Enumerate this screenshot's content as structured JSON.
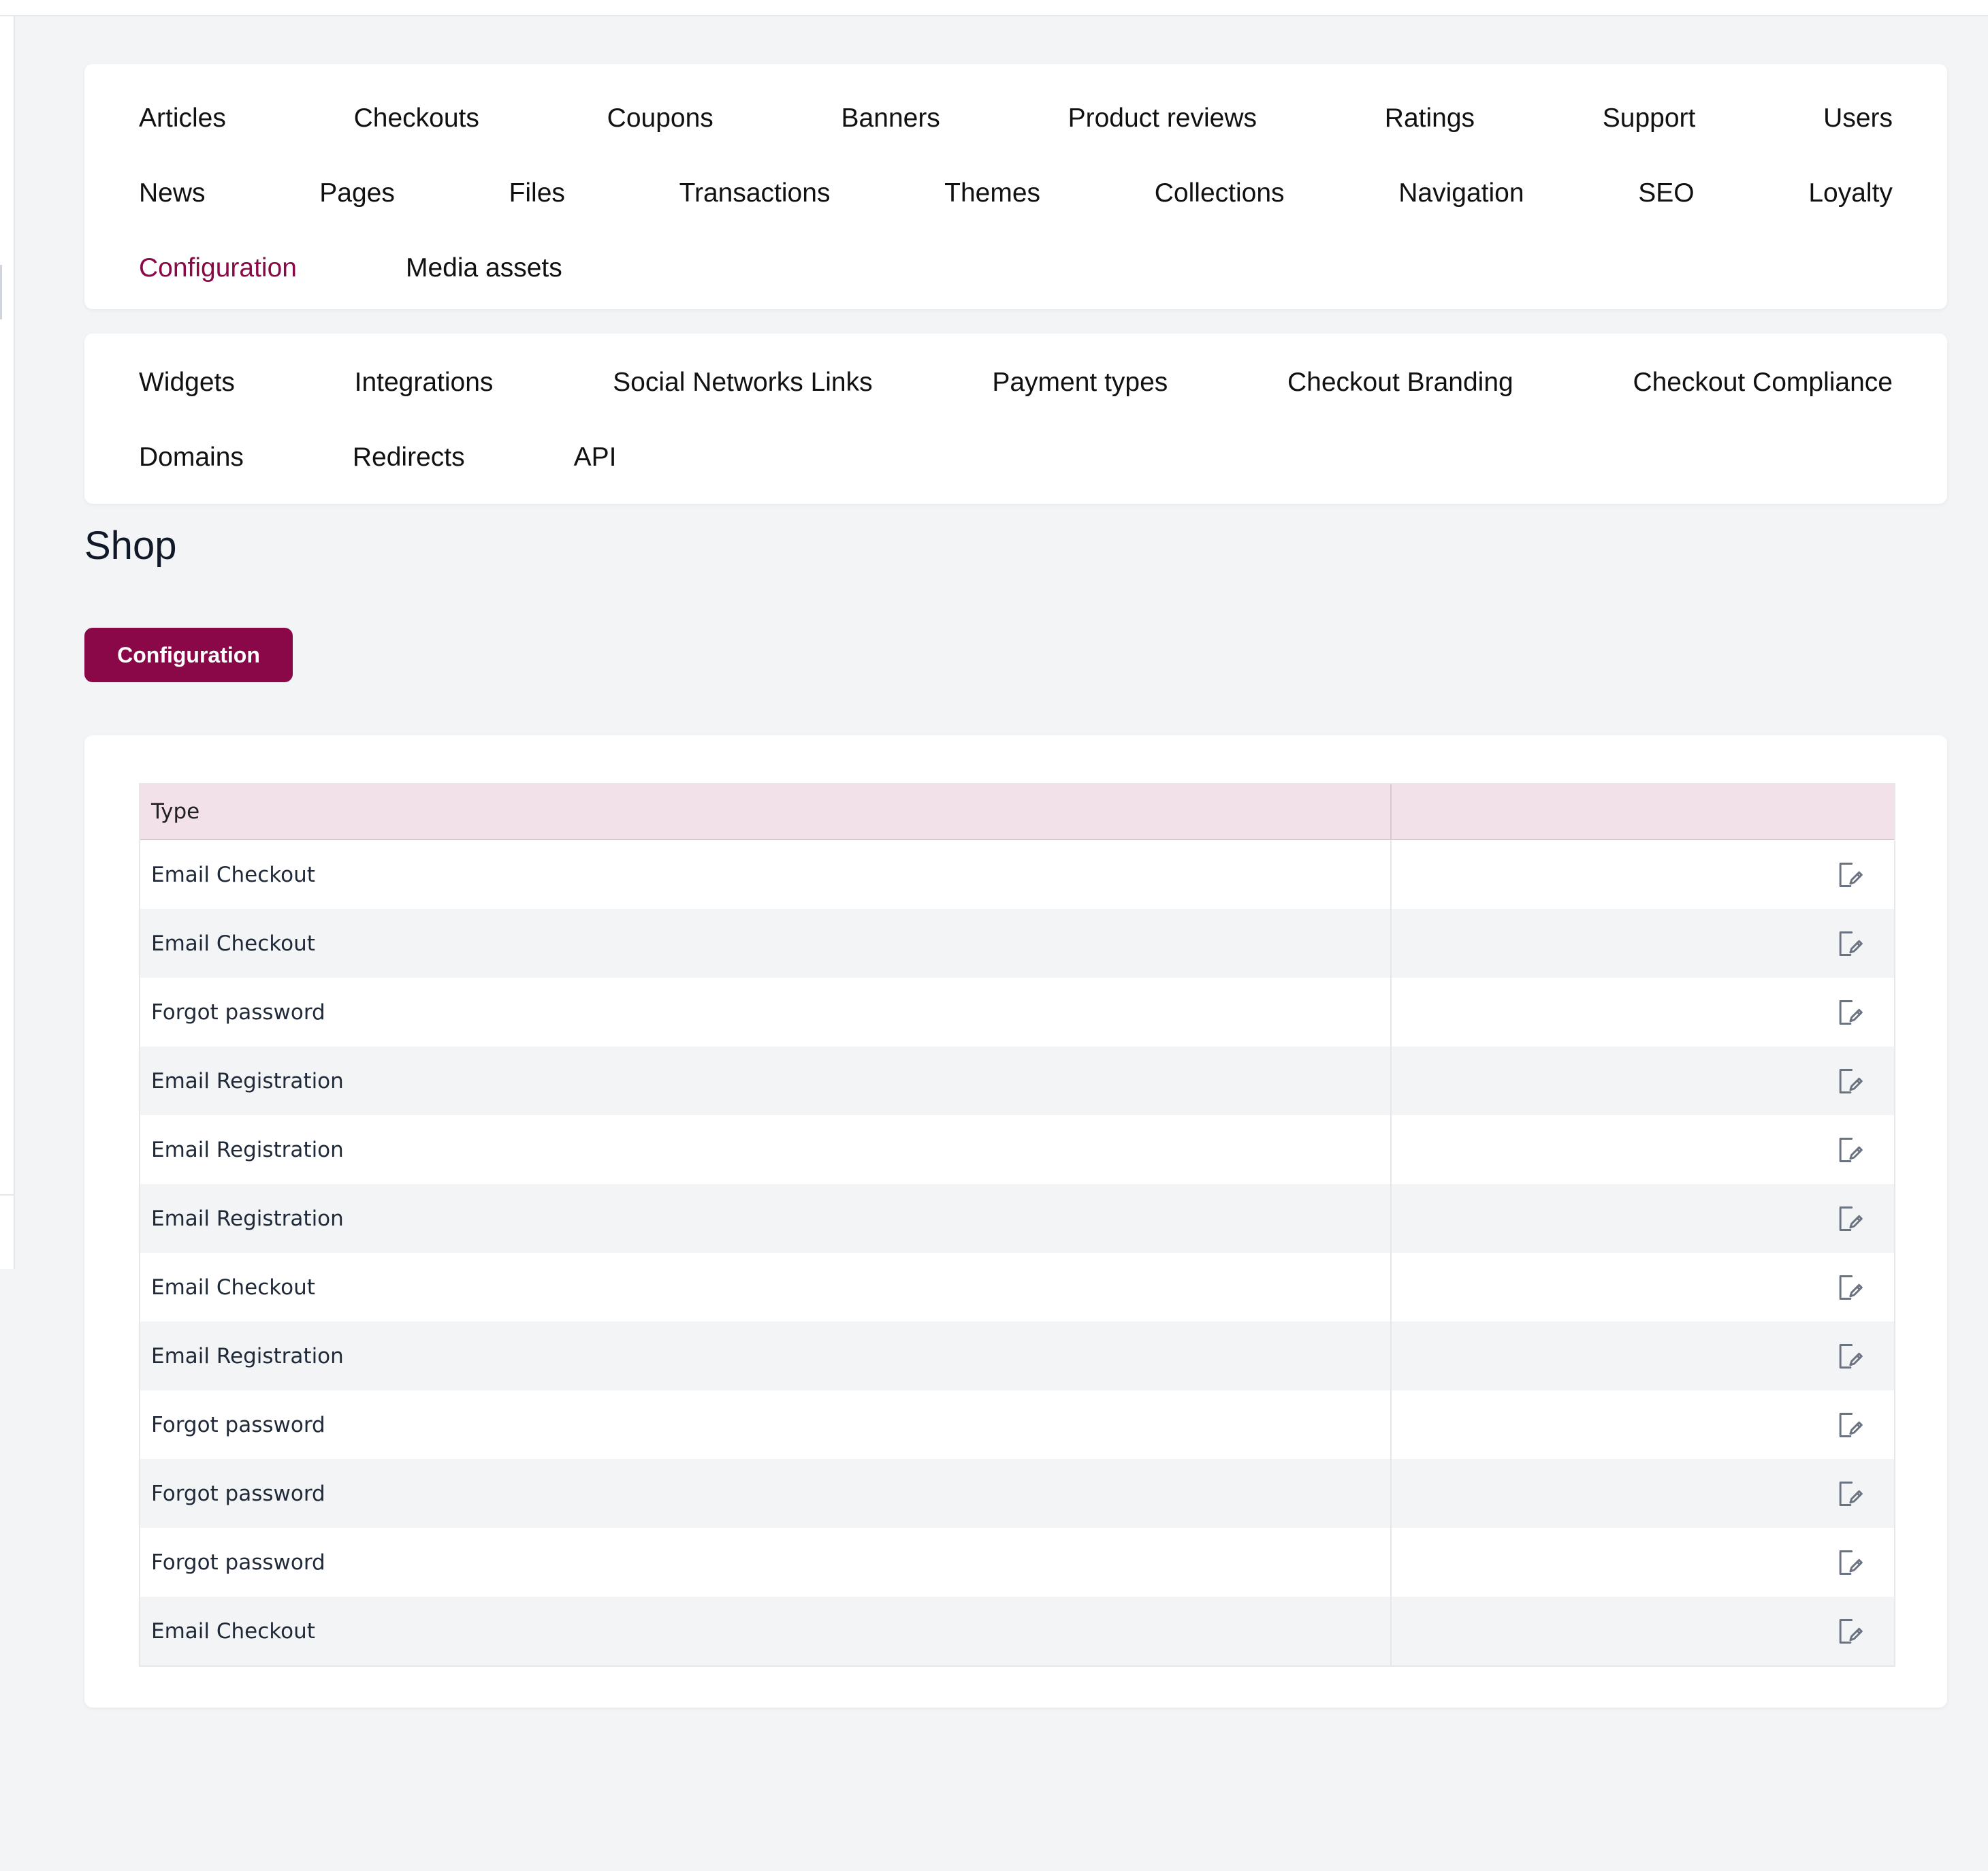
{
  "main_nav": {
    "rows": [
      [
        "Articles",
        "Checkouts",
        "Coupons",
        "Banners",
        "Product reviews",
        "Ratings",
        "Support",
        "Users"
      ],
      [
        "News",
        "Pages",
        "Files",
        "Transactions",
        "Themes",
        "Collections",
        "Navigation",
        "SEO",
        "Loyalty"
      ],
      [
        "Configuration",
        "Media assets"
      ]
    ],
    "active": "Configuration"
  },
  "sub_nav": {
    "rows": [
      [
        "Widgets",
        "Integrations",
        "Social Networks Links",
        "Payment types",
        "Checkout Branding",
        "Checkout Compliance"
      ],
      [
        "Domains",
        "Redirects",
        "API"
      ]
    ]
  },
  "page": {
    "title": "Shop",
    "config_button": "Configuration"
  },
  "table": {
    "columns": [
      "Type",
      ""
    ],
    "rows": [
      "Email Checkout",
      "Email Checkout",
      "Forgot password",
      "Email Registration",
      "Email Registration",
      "Email Registration",
      "Email Checkout",
      "Email Registration",
      "Forgot password",
      "Forgot password",
      "Forgot password",
      "Email Checkout"
    ],
    "row_action_icon": "edit-icon"
  },
  "colors": {
    "accent": "#8a0847",
    "table_header_bg": "#f3e1ea",
    "page_bg": "#f3f4f6"
  }
}
